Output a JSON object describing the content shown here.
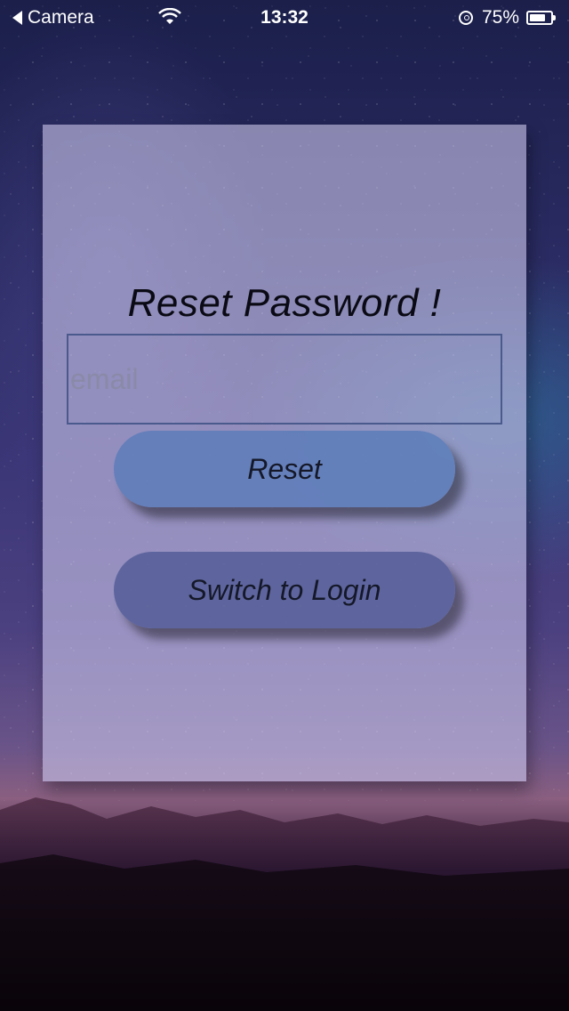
{
  "status_bar": {
    "back_label": "Camera",
    "time": "13:32",
    "battery_percent": "75%",
    "battery_level": 0.75
  },
  "card": {
    "title": "Reset Password !",
    "email": {
      "value": "",
      "placeholder": "email"
    },
    "reset_label": "Reset",
    "switch_label": "Switch to Login"
  },
  "colors": {
    "card_bg": "#c8c4e8",
    "reset_button": "#5c7cba",
    "switch_button": "#525c96",
    "field_border": "#4a5a8c"
  }
}
